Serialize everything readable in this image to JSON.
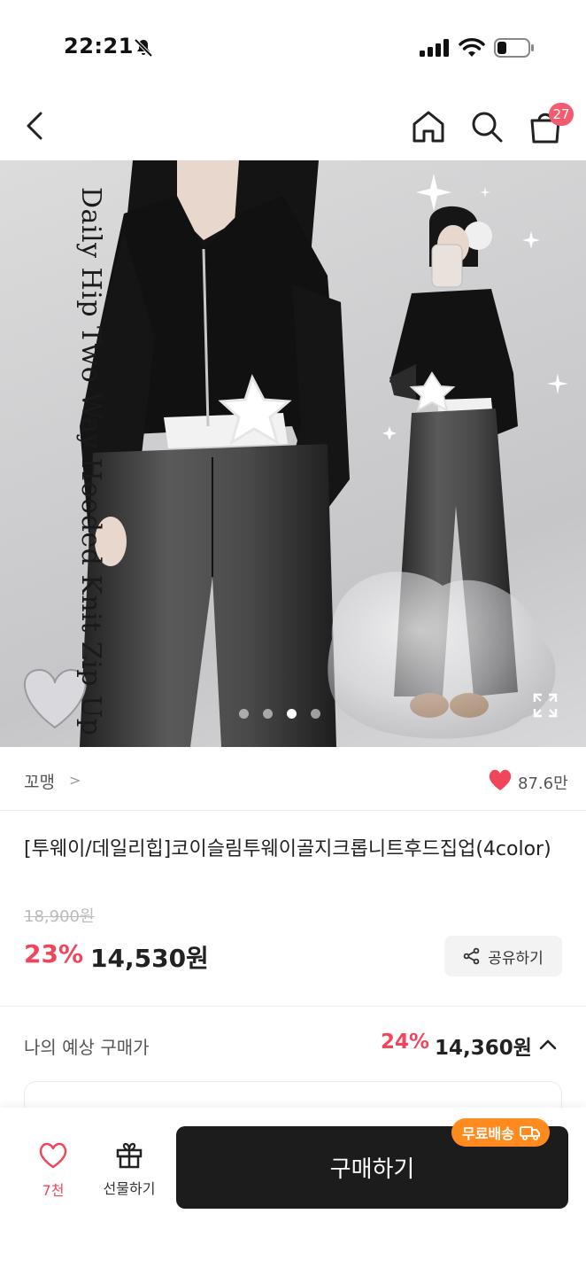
{
  "status_bar": {
    "time": "22:21"
  },
  "nav": {
    "cart_count": "27"
  },
  "hero": {
    "overlay_text": "Daily Hip Two Way Hooded Knit Zip Up",
    "slide_count": 4,
    "active_slide": 3
  },
  "brand": {
    "name": "꼬맹",
    "chevron": ">",
    "likes": "87.6만"
  },
  "product": {
    "title": "[투웨이/데일리힙]코이슬림투웨이골지크롭니트후드집업(4color)",
    "original_price": "18,900원",
    "discount": "23%",
    "price": "14,530원",
    "share_label": "공유하기"
  },
  "expected": {
    "label": "나의 예상 구매가",
    "discount": "24%",
    "price": "14,360원"
  },
  "bottom_bar": {
    "wish_label": "7천",
    "gift_label": "선물하기",
    "buy_label": "구매하기",
    "free_shipping": "무료배송"
  },
  "colors": {
    "accent": "#f0465b",
    "badge": "#f25c6e",
    "buy_button": "#1c1c1c",
    "free_ship": "#ff8a1e"
  }
}
